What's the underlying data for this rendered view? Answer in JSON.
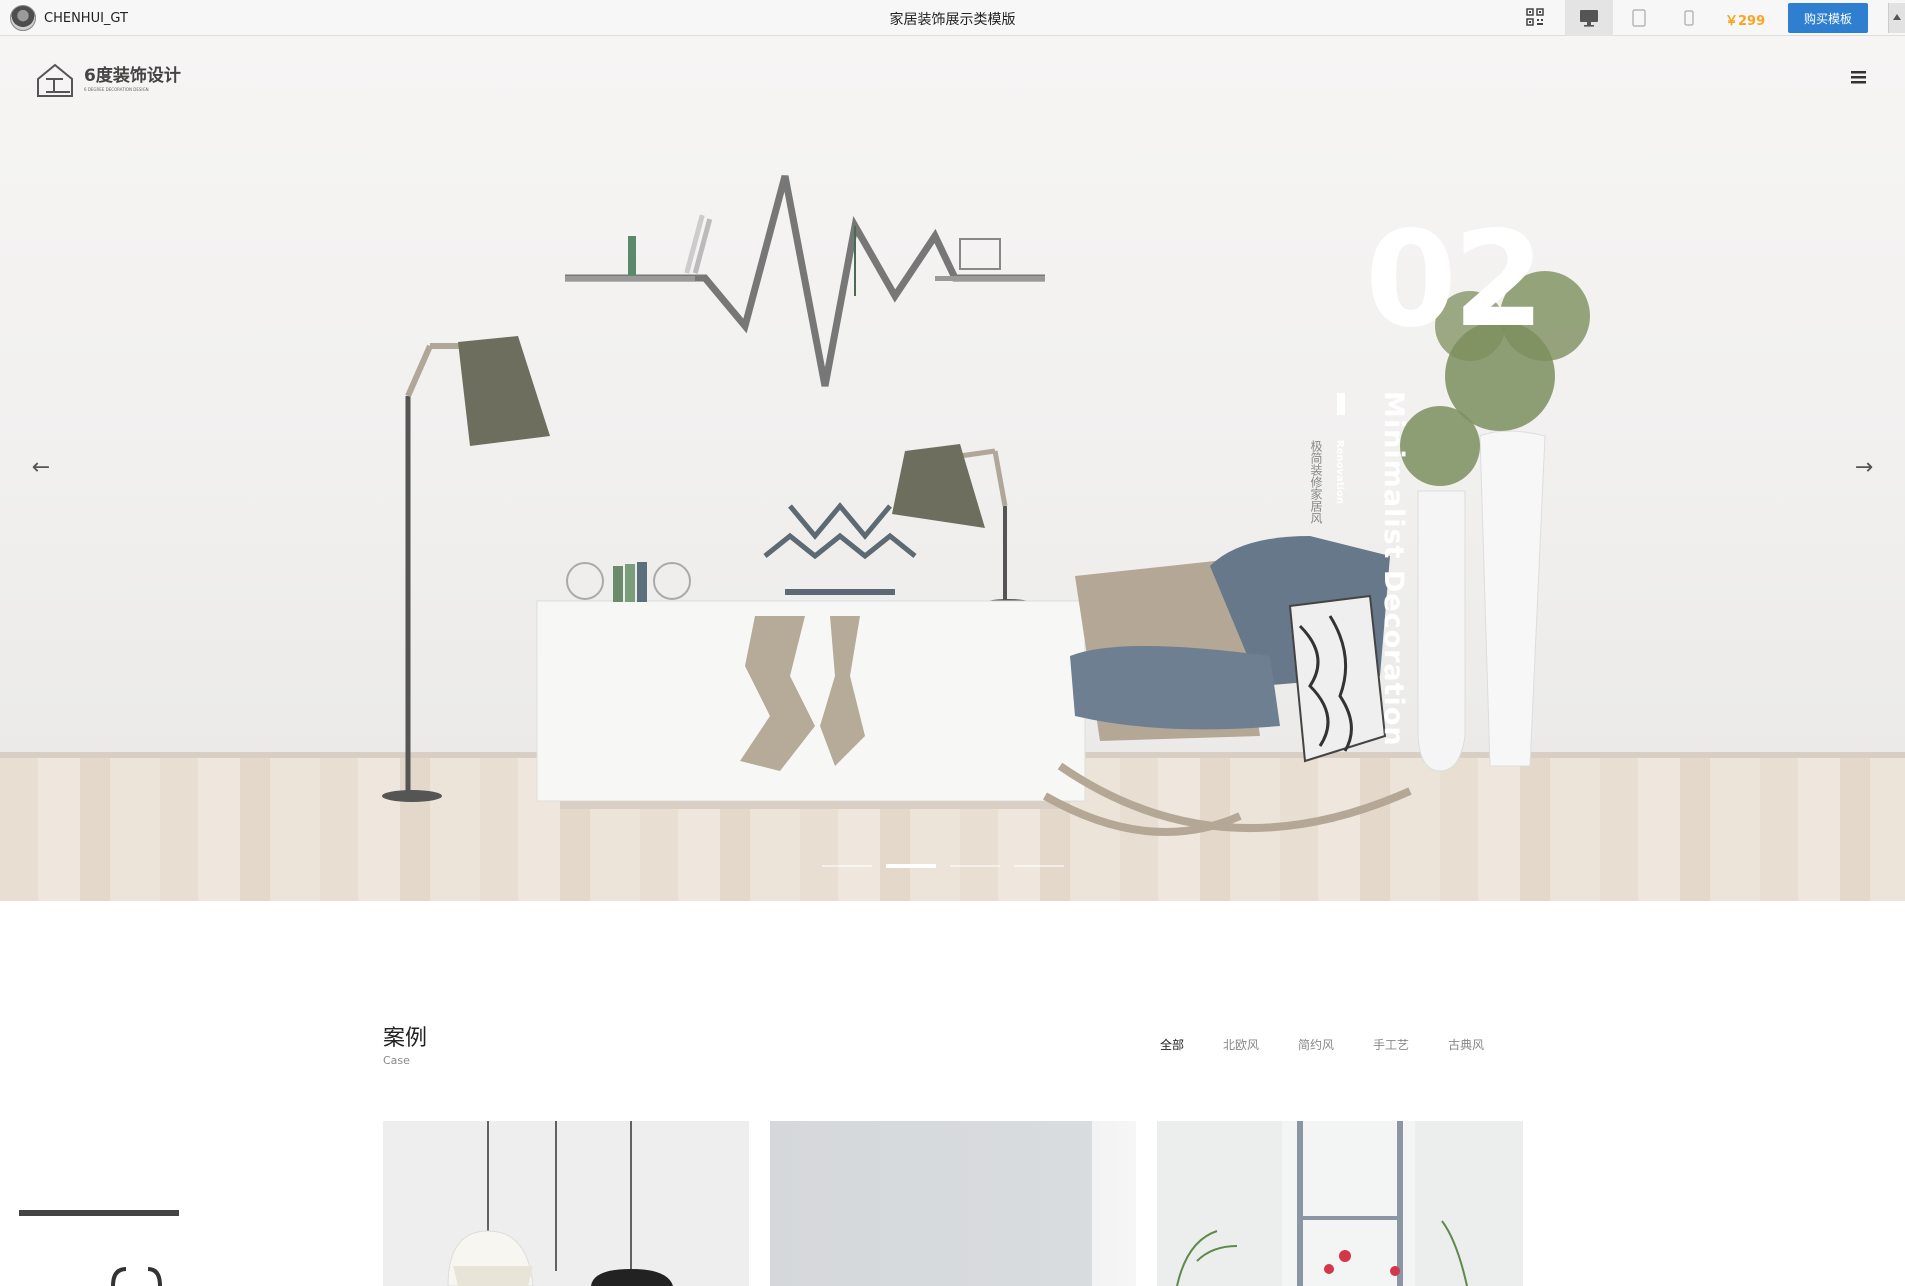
{
  "topbar": {
    "username": "CHENHUI_GT",
    "page_title": "家居装饰展示类模版",
    "price": "￥299",
    "buy_label": "购买模板",
    "icons": [
      "qr-code-icon",
      "desktop-icon",
      "tablet-icon",
      "mobile-icon"
    ]
  },
  "hero": {
    "logo_text": "6度装饰设计",
    "logo_sub": "6 DEGREE DECORATION DESIGN",
    "slide_number": "02",
    "slide_title": "Minimalist Decoration",
    "slide_sub": "Renovation",
    "slide_cn": "极简装修家居风",
    "prev_arrow": "←",
    "next_arrow": "→",
    "dots": [
      {
        "active": false
      },
      {
        "active": true
      },
      {
        "active": false
      },
      {
        "active": false
      }
    ],
    "current_slide": 2
  },
  "cases": {
    "title": "案例",
    "subtitle": "Case",
    "filters": [
      "全部",
      "北欧风",
      "简约风",
      "手工艺",
      "古典风"
    ],
    "active_filter": "全部"
  },
  "colors": {
    "accent": "#2f7fd1",
    "price": "#f5a623"
  }
}
